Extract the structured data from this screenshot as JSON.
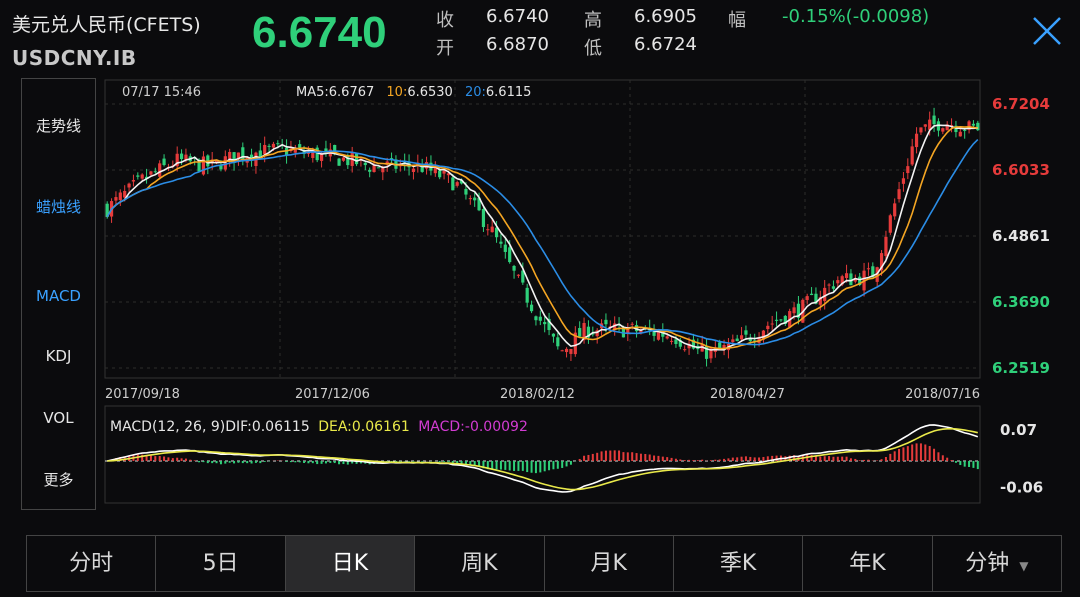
{
  "header": {
    "title": "美元兑人民币(CFETS)",
    "code": "USDCNY.IB",
    "price": "6.6740",
    "close_label": "收",
    "close_value": "6.6740",
    "open_label": "开",
    "open_value": "6.6870",
    "high_label": "高",
    "high_value": "6.6905",
    "low_label": "低",
    "low_value": "6.6724",
    "change_label": "幅",
    "change_value": "-0.15%(-0.0098)"
  },
  "sidebar": {
    "items": [
      {
        "label": "走势线",
        "active": false
      },
      {
        "label": "蜡烛线",
        "active": true
      },
      {
        "label": "MACD",
        "active": true
      },
      {
        "label": "KDJ",
        "active": false
      },
      {
        "label": "VOL",
        "active": false
      },
      {
        "label": "更多",
        "active": false
      }
    ]
  },
  "info": {
    "date": "07/17 15:46",
    "ma5_label": "MA5:",
    "ma5_value": "6.6767",
    "ma10_label": "10:",
    "ma10_value": "6.6530",
    "ma20_label": "20:",
    "ma20_value": "6.6115"
  },
  "macd_info": {
    "params": "MACD(12, 26, 9)",
    "dif": "DIF:0.06115",
    "dea": "DEA:0.06161",
    "macd": "MACD:-0.00092"
  },
  "tabs": [
    {
      "label": "分时",
      "active": false
    },
    {
      "label": "5日",
      "active": false
    },
    {
      "label": "日K",
      "active": true
    },
    {
      "label": "周K",
      "active": false
    },
    {
      "label": "月K",
      "active": false
    },
    {
      "label": "季K",
      "active": false
    },
    {
      "label": "年K",
      "active": false
    },
    {
      "label": "分钟",
      "active": false
    }
  ],
  "colors": {
    "up": "#e63b3b",
    "down": "#2fd07a",
    "ma5": "#f3f3f3",
    "ma10": "#f5a623",
    "ma20": "#2b8de6",
    "dif": "#ffffff",
    "dea": "#e9e94a",
    "macd_label": "#d23cd2",
    "accent": "#3aa1ff"
  },
  "chart_data": [
    {
      "type": "candlestick",
      "title": "USDCNY.IB 日K",
      "x_ticks": [
        "2017/09/18",
        "2017/12/06",
        "2018/02/12",
        "2018/04/27",
        "2018/07/16"
      ],
      "y_ticks": [
        "6.7204",
        "6.6033",
        "6.4861",
        "6.3690",
        "6.2519"
      ],
      "y_tick_colors": [
        "up",
        "up",
        "neutral",
        "down",
        "down"
      ],
      "ylim": [
        6.2519,
        6.7204
      ],
      "anchors_x": [
        0,
        0.04,
        0.08,
        0.12,
        0.15,
        0.2,
        0.24,
        0.28,
        0.3,
        0.33,
        0.36,
        0.4,
        0.44,
        0.47,
        0.5,
        0.52,
        0.55,
        0.6,
        0.65,
        0.68,
        0.7,
        0.73,
        0.76,
        0.8,
        0.84,
        0.86,
        0.88,
        0.9,
        0.93,
        0.96,
        1
      ],
      "close_path": [
        6.535,
        6.585,
        6.62,
        6.61,
        6.63,
        6.64,
        6.63,
        6.62,
        6.61,
        6.61,
        6.61,
        6.58,
        6.5,
        6.41,
        6.33,
        6.28,
        6.32,
        6.32,
        6.31,
        6.28,
        6.28,
        6.3,
        6.33,
        6.36,
        6.41,
        6.41,
        6.42,
        6.52,
        6.67,
        6.69,
        6.674
      ],
      "ma5_last": 6.6767,
      "ma10_last": 6.653,
      "ma20_last": 6.6115
    },
    {
      "type": "line",
      "title": "MACD(12, 26, 9)",
      "y_ticks": [
        "0.07",
        "-0.06"
      ],
      "ylim": [
        -0.08,
        0.1
      ],
      "dif_last": 0.06115,
      "dea_last": 0.06161,
      "macd_last": -0.00092
    }
  ]
}
